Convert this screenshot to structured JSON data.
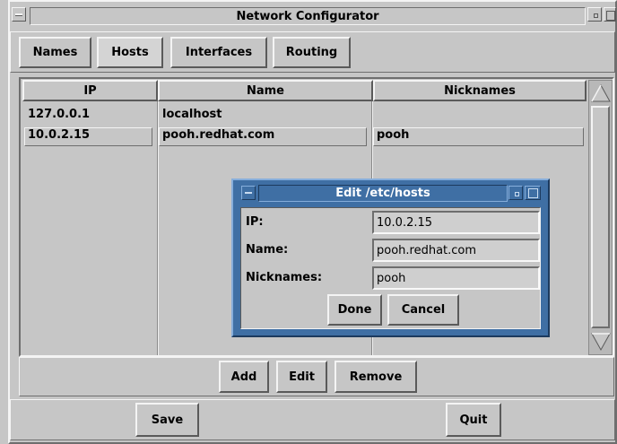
{
  "window": {
    "title": "Network Configurator"
  },
  "tabs": [
    {
      "label": "Names"
    },
    {
      "label": "Hosts"
    },
    {
      "label": "Interfaces"
    },
    {
      "label": "Routing"
    }
  ],
  "table": {
    "columns": [
      "IP",
      "Name",
      "Nicknames"
    ],
    "rows": [
      {
        "ip": "127.0.0.1",
        "name": "localhost",
        "nicknames": ""
      },
      {
        "ip": "10.0.2.15",
        "name": "pooh.redhat.com",
        "nicknames": "pooh"
      }
    ]
  },
  "row_actions": {
    "add": "Add",
    "edit": "Edit",
    "remove": "Remove"
  },
  "footer": {
    "save": "Save",
    "quit": "Quit"
  },
  "dialog": {
    "title": "Edit /etc/hosts",
    "fields": {
      "ip_label": "IP:",
      "ip_value": "10.0.2.15",
      "name_label": "Name:",
      "name_value": "pooh.redhat.com",
      "nick_label": "Nicknames:",
      "nick_value": "pooh"
    },
    "done": "Done",
    "cancel": "Cancel"
  }
}
